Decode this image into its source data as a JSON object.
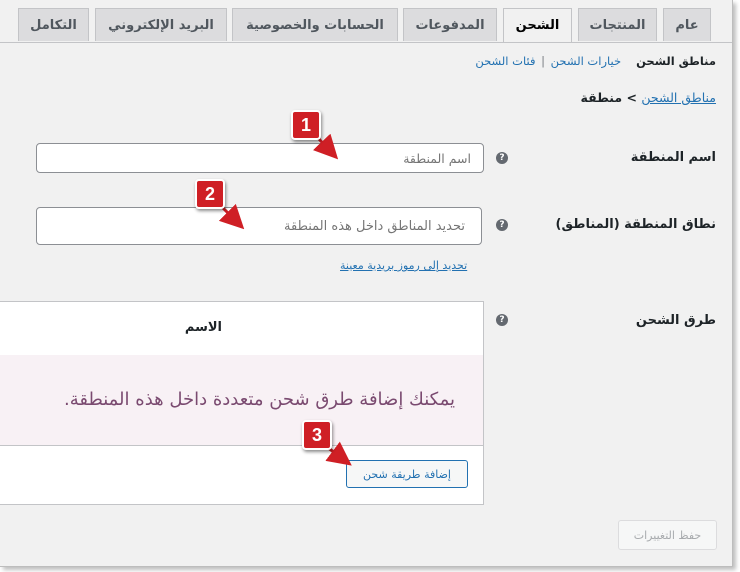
{
  "tabs": [
    {
      "label": "عام"
    },
    {
      "label": "المنتجات"
    },
    {
      "label": "الشحن"
    },
    {
      "label": "المدفوعات"
    },
    {
      "label": "الحسابات والخصوصية"
    },
    {
      "label": "البريد الإلكتروني"
    },
    {
      "label": "التكامل"
    }
  ],
  "active_tab": "الشحن",
  "subnav": {
    "current": "مناطق الشحن",
    "options": "خيارات الشحن",
    "classes": "فئات الشحن",
    "separator": "|"
  },
  "breadcrumb": {
    "link": "مناطق الشحن",
    "separator": ">",
    "current": "منطقة"
  },
  "form": {
    "zone_name_label": "اسم المنطقة",
    "zone_name_placeholder": "اسم المنطقة",
    "zone_regions_label": "نطاق المنطقة (المناطق)",
    "zone_regions_placeholder": "تحديد المناطق داخل هذه المنطقة",
    "postcodes_link": "تحديد إلى رموز بريدية معينة",
    "methods_label": "طرق الشحن",
    "help_glyph": "?"
  },
  "methods_table": {
    "column_name": "الاسم",
    "empty_message": "يمكنك إضافة طرق شحن متعددة داخل هذه المنطقة.",
    "add_button": "إضافة طريقة شحن"
  },
  "save_button": "حفظ التغييرات",
  "annotations": [
    "1",
    "2",
    "3"
  ],
  "colors": {
    "link": "#2271b1",
    "badge": "#cf1f25",
    "empty_bg": "#f8f1f5",
    "empty_text": "#7a4a70"
  }
}
